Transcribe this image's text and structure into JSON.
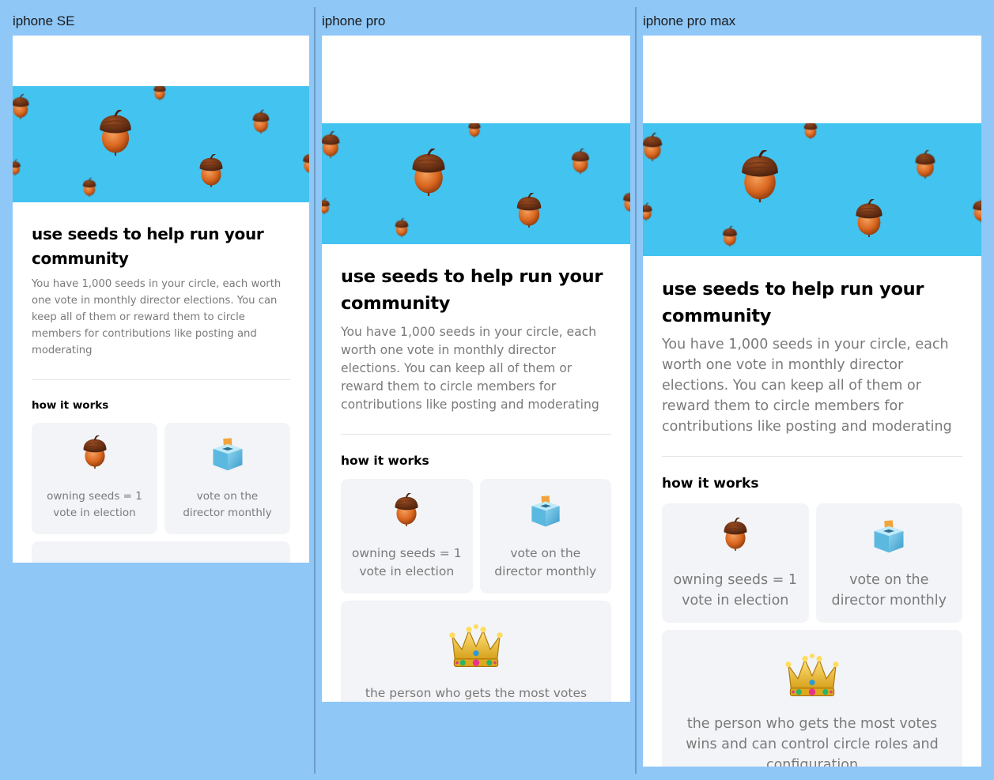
{
  "frames": {
    "se": {
      "label": "iphone SE"
    },
    "pro": {
      "label": "iphone pro"
    },
    "max": {
      "label": "iphone pro max"
    }
  },
  "content": {
    "title": "use seeds to help run your community",
    "description": "You have 1,000 seeds in your circle, each worth one vote in monthly director elections. You can keep all of them or reward them to circle members for contributions like posting and moderating",
    "how_it_works": "how it works",
    "cards": [
      {
        "icon": "acorn-icon",
        "text": "owning seeds = 1 vote in election"
      },
      {
        "icon": "ballot-box-icon",
        "text": "vote on the director monthly"
      },
      {
        "icon": "crown-icon",
        "text": "the person who gets the most votes wins and can control circle roles and configuration"
      }
    ]
  },
  "colors": {
    "background": "#8fc7f7",
    "hero": "#42c3f0",
    "card": "#f2f4f7",
    "muted_text": "#7a7a7a"
  }
}
